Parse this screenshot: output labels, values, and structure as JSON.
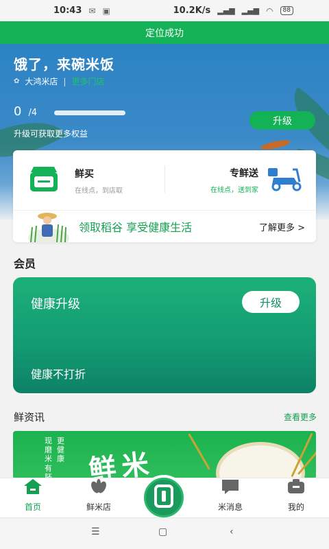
{
  "status_bar": {
    "time": "10:43",
    "network_speed": "10.2K/s",
    "battery": "88"
  },
  "toast": "定位成功",
  "hero": {
    "title": "饿了，来碗米饭",
    "store_name": "大鸿米店",
    "separator": "|",
    "more_stores": "更多门店",
    "progress_current": "0",
    "progress_total": "/4",
    "progress_fraction": 0.0,
    "benefit_text": "升级可获取更多权益",
    "upgrade_label": "升级"
  },
  "services": {
    "fresh_buy": {
      "title": "鲜买",
      "subtitle": "在线点，到店取"
    },
    "delivery": {
      "title": "专鲜送",
      "subtitle": "在线点，送到家"
    },
    "promo_text": "领取稻谷 享受健康生活",
    "learn_more": "了解更多 >"
  },
  "member": {
    "section_title": "会员",
    "card_title": "健康升级",
    "card_upgrade": "升级",
    "card_subtitle": "健康不打折"
  },
  "news": {
    "title": "鲜资讯",
    "more": "查看更多",
    "banner_line1": "现磨米",
    "banner_line2": "更健康",
    "banner_line3": "有胚",
    "banner_big": "鲜米"
  },
  "tabs": [
    {
      "label": "首页",
      "icon": "home-icon",
      "active": true
    },
    {
      "label": "鲜米店",
      "icon": "rice-leaf-icon",
      "active": false
    },
    {
      "label": "",
      "icon": "scan-icon",
      "active": false
    },
    {
      "label": "米消息",
      "icon": "message-icon",
      "active": false
    },
    {
      "label": "我的",
      "icon": "profile-icon",
      "active": false
    }
  ],
  "colors": {
    "brand_green": "#14b257",
    "hero_blue": "#2c82c3",
    "member_green": "#129a72"
  }
}
